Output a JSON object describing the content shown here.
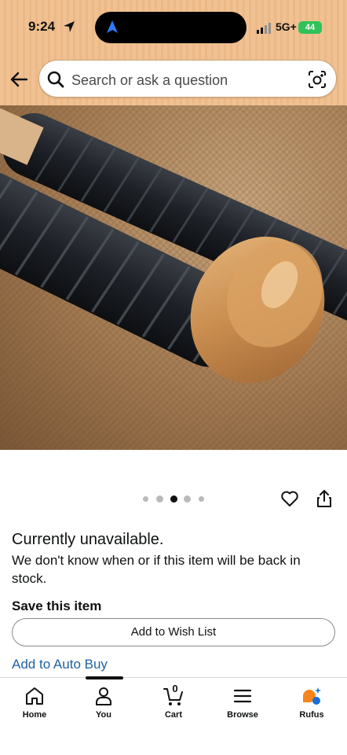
{
  "status_bar": {
    "time": "9:24",
    "network": "5G+",
    "battery": "44"
  },
  "search": {
    "placeholder": "Search or ask a question"
  },
  "gallery": {
    "dot_count": 5,
    "active_index": 2
  },
  "availability": {
    "title": "Currently unavailable.",
    "description": "We don't know when or if this item will be back in stock."
  },
  "save_section": {
    "heading": "Save this item",
    "wishlist_label": "Add to Wish List",
    "autobuy_label": "Add to Auto Buy"
  },
  "tab_bar": {
    "active_tab": "You",
    "cart_count": "0",
    "items": [
      {
        "label": "Home",
        "icon": "home-icon"
      },
      {
        "label": "You",
        "icon": "person-icon"
      },
      {
        "label": "Cart",
        "icon": "cart-icon"
      },
      {
        "label": "Browse",
        "icon": "menu-icon"
      },
      {
        "label": "Rufus",
        "icon": "rufus-icon"
      }
    ]
  },
  "colors": {
    "header_bg": "#f0c192",
    "link": "#2162a1",
    "battery": "#30c25a",
    "rufus_orange": "#f7851c",
    "rufus_blue": "#1a6fd6"
  }
}
